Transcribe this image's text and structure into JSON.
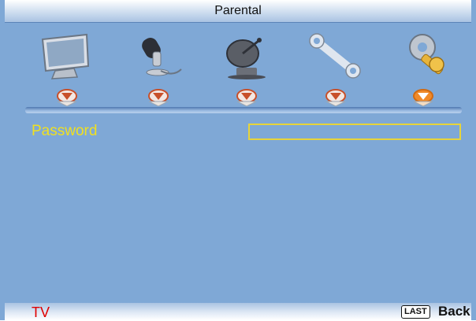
{
  "menu": {
    "title": "Parental",
    "icons": [
      {
        "name": "picture-menu-icon"
      },
      {
        "name": "audio-menu-icon"
      },
      {
        "name": "channel-menu-icon"
      },
      {
        "name": "setup-menu-icon"
      },
      {
        "name": "parental-lock-menu-icon"
      }
    ],
    "selected_index": 4,
    "colors": {
      "background": "#7fa8d6",
      "label": "#f0e020",
      "marker_normal": "#c8502a",
      "marker_active": "#f08a2a"
    }
  },
  "password": {
    "label": "Password",
    "value": ""
  },
  "footer": {
    "source": "TV",
    "key": "LAST",
    "action": "Back"
  }
}
